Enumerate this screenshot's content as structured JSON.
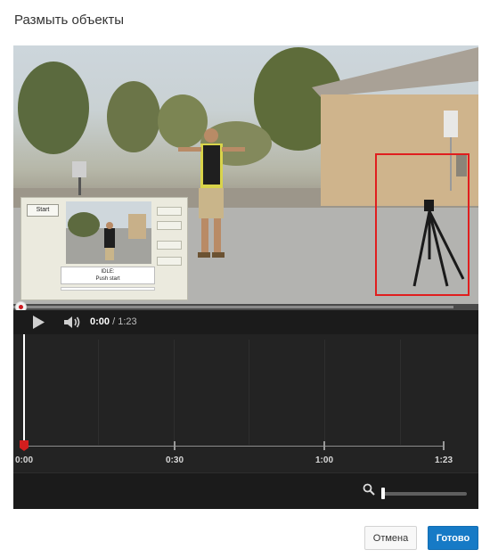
{
  "dialog": {
    "title": "Размыть объекты"
  },
  "video": {
    "pip": {
      "start_label": "Start",
      "status_line1": "IDLE:",
      "status_line2": "Push start"
    },
    "selection_color": "#e01e1e"
  },
  "player": {
    "progress_fraction": 0.0,
    "time_current": "0:00",
    "time_separator": " / ",
    "time_total": "1:23",
    "icons": [
      "play-icon",
      "volume-icon"
    ]
  },
  "timeline": {
    "ticks": [
      {
        "label": "0:00"
      },
      {
        "label": "0:30"
      },
      {
        "label": "1:00"
      },
      {
        "label": "1:23"
      }
    ],
    "playhead_color": "#d31e1e"
  },
  "zoom": {
    "icon": "zoom-icon",
    "level_fraction": 0.0
  },
  "buttons": {
    "cancel_label": "Отмена",
    "done_label": "Готово",
    "accent_color": "#167ac6"
  }
}
